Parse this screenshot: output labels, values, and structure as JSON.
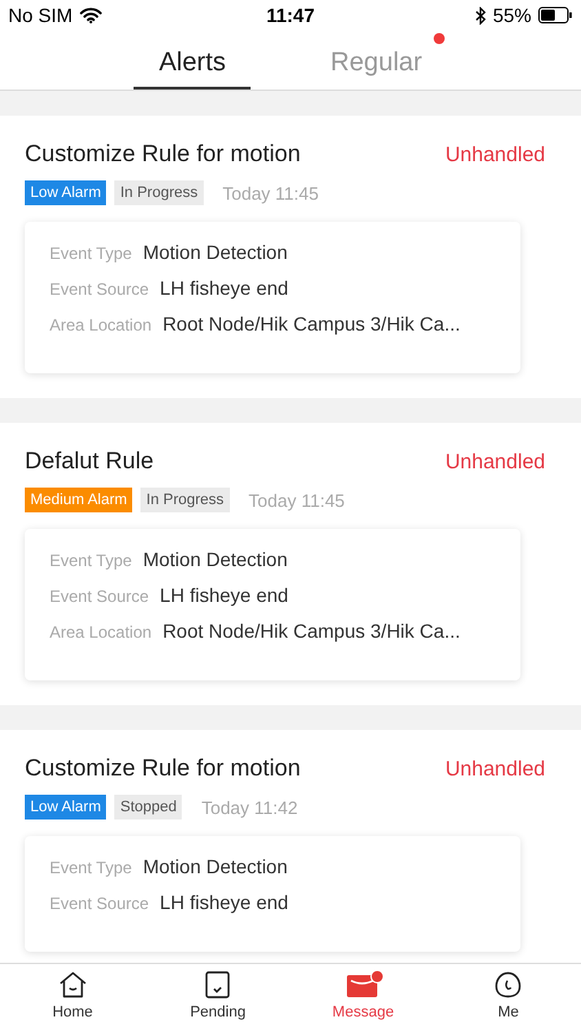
{
  "status_bar": {
    "carrier": "No SIM",
    "time": "11:47",
    "battery": "55%"
  },
  "tabs": [
    {
      "label": "Alerts",
      "selected": true,
      "badge": false
    },
    {
      "label": "Regular",
      "selected": false,
      "badge": true
    }
  ],
  "alerts": [
    {
      "title": "Customize Rule for motion",
      "status": "Unhandled",
      "level_tag": {
        "label": "Low Alarm",
        "color": "#1e88e5"
      },
      "progress": "In Progress",
      "time": "Today 11:45",
      "fields": [
        {
          "label": "Event Type",
          "value": "Motion Detection"
        },
        {
          "label": "Event Source",
          "value": "LH fisheye end"
        },
        {
          "label": "Area Location",
          "value": "Root Node/Hik Campus 3/Hik Ca..."
        }
      ]
    },
    {
      "title": "Defalut Rule",
      "status": "Unhandled",
      "level_tag": {
        "label": "Medium Alarm",
        "color": "#fb8c00"
      },
      "progress": "In Progress",
      "time": "Today 11:45",
      "fields": [
        {
          "label": "Event Type",
          "value": "Motion Detection"
        },
        {
          "label": "Event Source",
          "value": "LH fisheye end"
        },
        {
          "label": "Area Location",
          "value": "Root Node/Hik Campus 3/Hik Ca..."
        }
      ]
    },
    {
      "title": "Customize Rule for motion",
      "status": "Unhandled",
      "level_tag": {
        "label": "Low Alarm",
        "color": "#1e88e5"
      },
      "progress": "Stopped",
      "time": "Today 11:42",
      "fields": [
        {
          "label": "Event Type",
          "value": "Motion Detection"
        },
        {
          "label": "Event Source",
          "value": "LH fisheye end"
        }
      ]
    }
  ],
  "nav": [
    {
      "kind": "home",
      "label": "Home",
      "selected": false,
      "badge": false
    },
    {
      "kind": "pending",
      "label": "Pending",
      "selected": false,
      "badge": false
    },
    {
      "kind": "message",
      "label": "Message",
      "selected": true,
      "badge": true
    },
    {
      "kind": "me",
      "label": "Me",
      "selected": false,
      "badge": false
    }
  ]
}
